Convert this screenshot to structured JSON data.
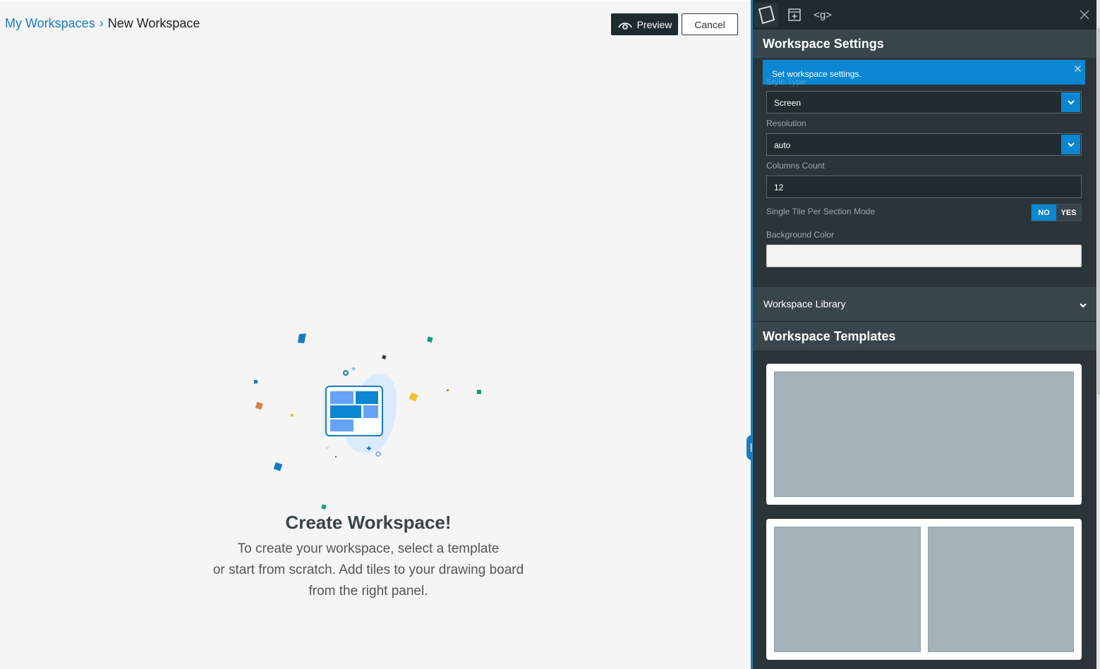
{
  "breadcrumb": {
    "parent": "My Workspaces",
    "separator": "›",
    "current": "New Workspace"
  },
  "toolbar": {
    "preview_label": "Preview",
    "cancel_label": "Cancel"
  },
  "empty_state": {
    "title": "Create Workspace!",
    "lines": [
      "To create your workspace, select a template",
      "or start from scratch. Add tiles to your drawing board",
      "from the right panel."
    ]
  },
  "panel": {
    "tabs": [
      {
        "icon": "workspace-settings-icon"
      },
      {
        "icon": "add-tile-icon"
      },
      {
        "icon": "code-icon",
        "label": "<g>"
      }
    ],
    "settings_title": "Workspace Settings",
    "info_banner": "Set workspace settings.",
    "fields": {
      "style_type": {
        "label": "Style Type",
        "value": "Screen"
      },
      "resolution": {
        "label": "Resolution",
        "value": "auto"
      },
      "columns_count": {
        "label": "Columns Count",
        "value": "12"
      },
      "single_tile": {
        "label": "Single Tile Per Section Mode",
        "no": "NO",
        "yes": "YES",
        "selected": "NO"
      },
      "background_color": {
        "label": "Background Color",
        "value": ""
      }
    },
    "library_title": "Workspace Library",
    "templates_title": "Workspace Templates"
  },
  "colors": {
    "accent": "#0b86d1",
    "panel_bg": "#2b3539",
    "section_bg": "#38464c",
    "canvas_bg": "#f5f5f5"
  }
}
